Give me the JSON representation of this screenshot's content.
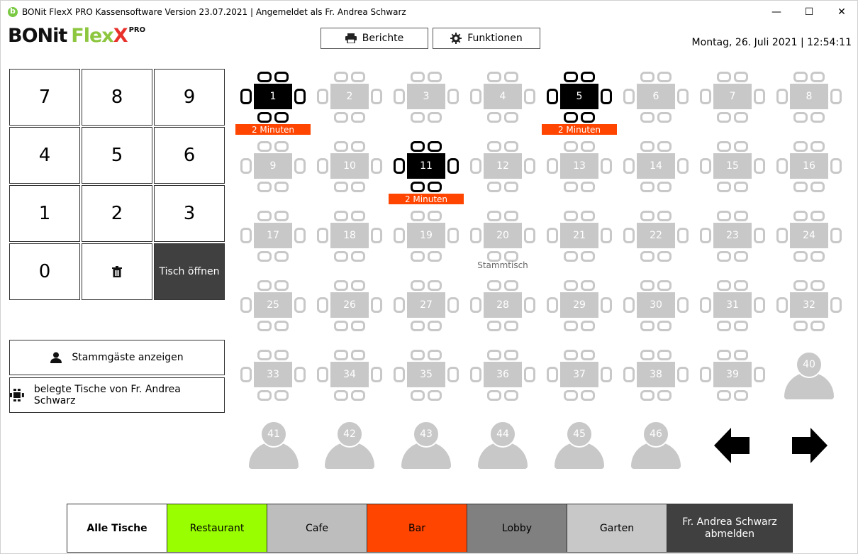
{
  "window": {
    "title": "BONit FlexX PRO Kassensoftware Version 23.07.2021 | Angemeldet als Fr. Andrea Schwarz",
    "minimize": "—",
    "maximize": "☐",
    "close": "✕"
  },
  "logo": {
    "part1": "BONit",
    "part2": "Flex",
    "part3": "X",
    "suffix": "PRO"
  },
  "header": {
    "reports_label": "Berichte",
    "functions_label": "Funktionen",
    "datetime": "Montag, 26. Juli 2021 | 12:54:11"
  },
  "keypad": {
    "keys": [
      "7",
      "8",
      "9",
      "4",
      "5",
      "6",
      "1",
      "2",
      "3",
      "0"
    ],
    "open_table_label": "Tisch öffnen"
  },
  "actions": {
    "regulars_label": "Stammgäste anzeigen",
    "occupied_label": "belegte Tische von Fr. Andrea Schwarz"
  },
  "tables": [
    {
      "n": "1",
      "occupied": true,
      "timer": "2 Minuten"
    },
    {
      "n": "2"
    },
    {
      "n": "3"
    },
    {
      "n": "4"
    },
    {
      "n": "5",
      "occupied": true,
      "timer": "2 Minuten"
    },
    {
      "n": "6"
    },
    {
      "n": "7"
    },
    {
      "n": "8"
    },
    {
      "n": "9"
    },
    {
      "n": "10"
    },
    {
      "n": "11",
      "occupied": true,
      "timer": "2 Minuten"
    },
    {
      "n": "12"
    },
    {
      "n": "13"
    },
    {
      "n": "14"
    },
    {
      "n": "15"
    },
    {
      "n": "16"
    },
    {
      "n": "17"
    },
    {
      "n": "18"
    },
    {
      "n": "19"
    },
    {
      "n": "20",
      "note": "Stammtisch"
    },
    {
      "n": "21"
    },
    {
      "n": "22"
    },
    {
      "n": "23"
    },
    {
      "n": "24"
    },
    {
      "n": "25"
    },
    {
      "n": "26"
    },
    {
      "n": "27"
    },
    {
      "n": "28"
    },
    {
      "n": "29"
    },
    {
      "n": "30"
    },
    {
      "n": "31"
    },
    {
      "n": "32"
    },
    {
      "n": "33"
    },
    {
      "n": "34"
    },
    {
      "n": "35"
    },
    {
      "n": "36"
    },
    {
      "n": "37"
    },
    {
      "n": "38"
    },
    {
      "n": "39"
    }
  ],
  "guests": [
    "40",
    "41",
    "42",
    "43",
    "44",
    "45",
    "46"
  ],
  "tabs": [
    {
      "label": "Alle Tische",
      "color": "#ffffff",
      "text": "#000000",
      "bold": true
    },
    {
      "label": "Restaurant",
      "color": "#99ff00",
      "text": "#000000"
    },
    {
      "label": "Cafe",
      "color": "#bdbdbd",
      "text": "#000000"
    },
    {
      "label": "Bar",
      "color": "#ff4500",
      "text": "#000000"
    },
    {
      "label": "Lobby",
      "color": "#808080",
      "text": "#000000"
    },
    {
      "label": "Garten",
      "color": "#c8c8c8",
      "text": "#000000"
    },
    {
      "label": "Fr. Andrea Schwarz abmelden",
      "color": "#404040",
      "text": "#ffffff"
    }
  ],
  "colors": {
    "occupied": "#000000",
    "free": "#c8c8c8",
    "timer": "#ff4500",
    "accent_green": "#8dc63f",
    "accent_red": "#e8312b"
  }
}
